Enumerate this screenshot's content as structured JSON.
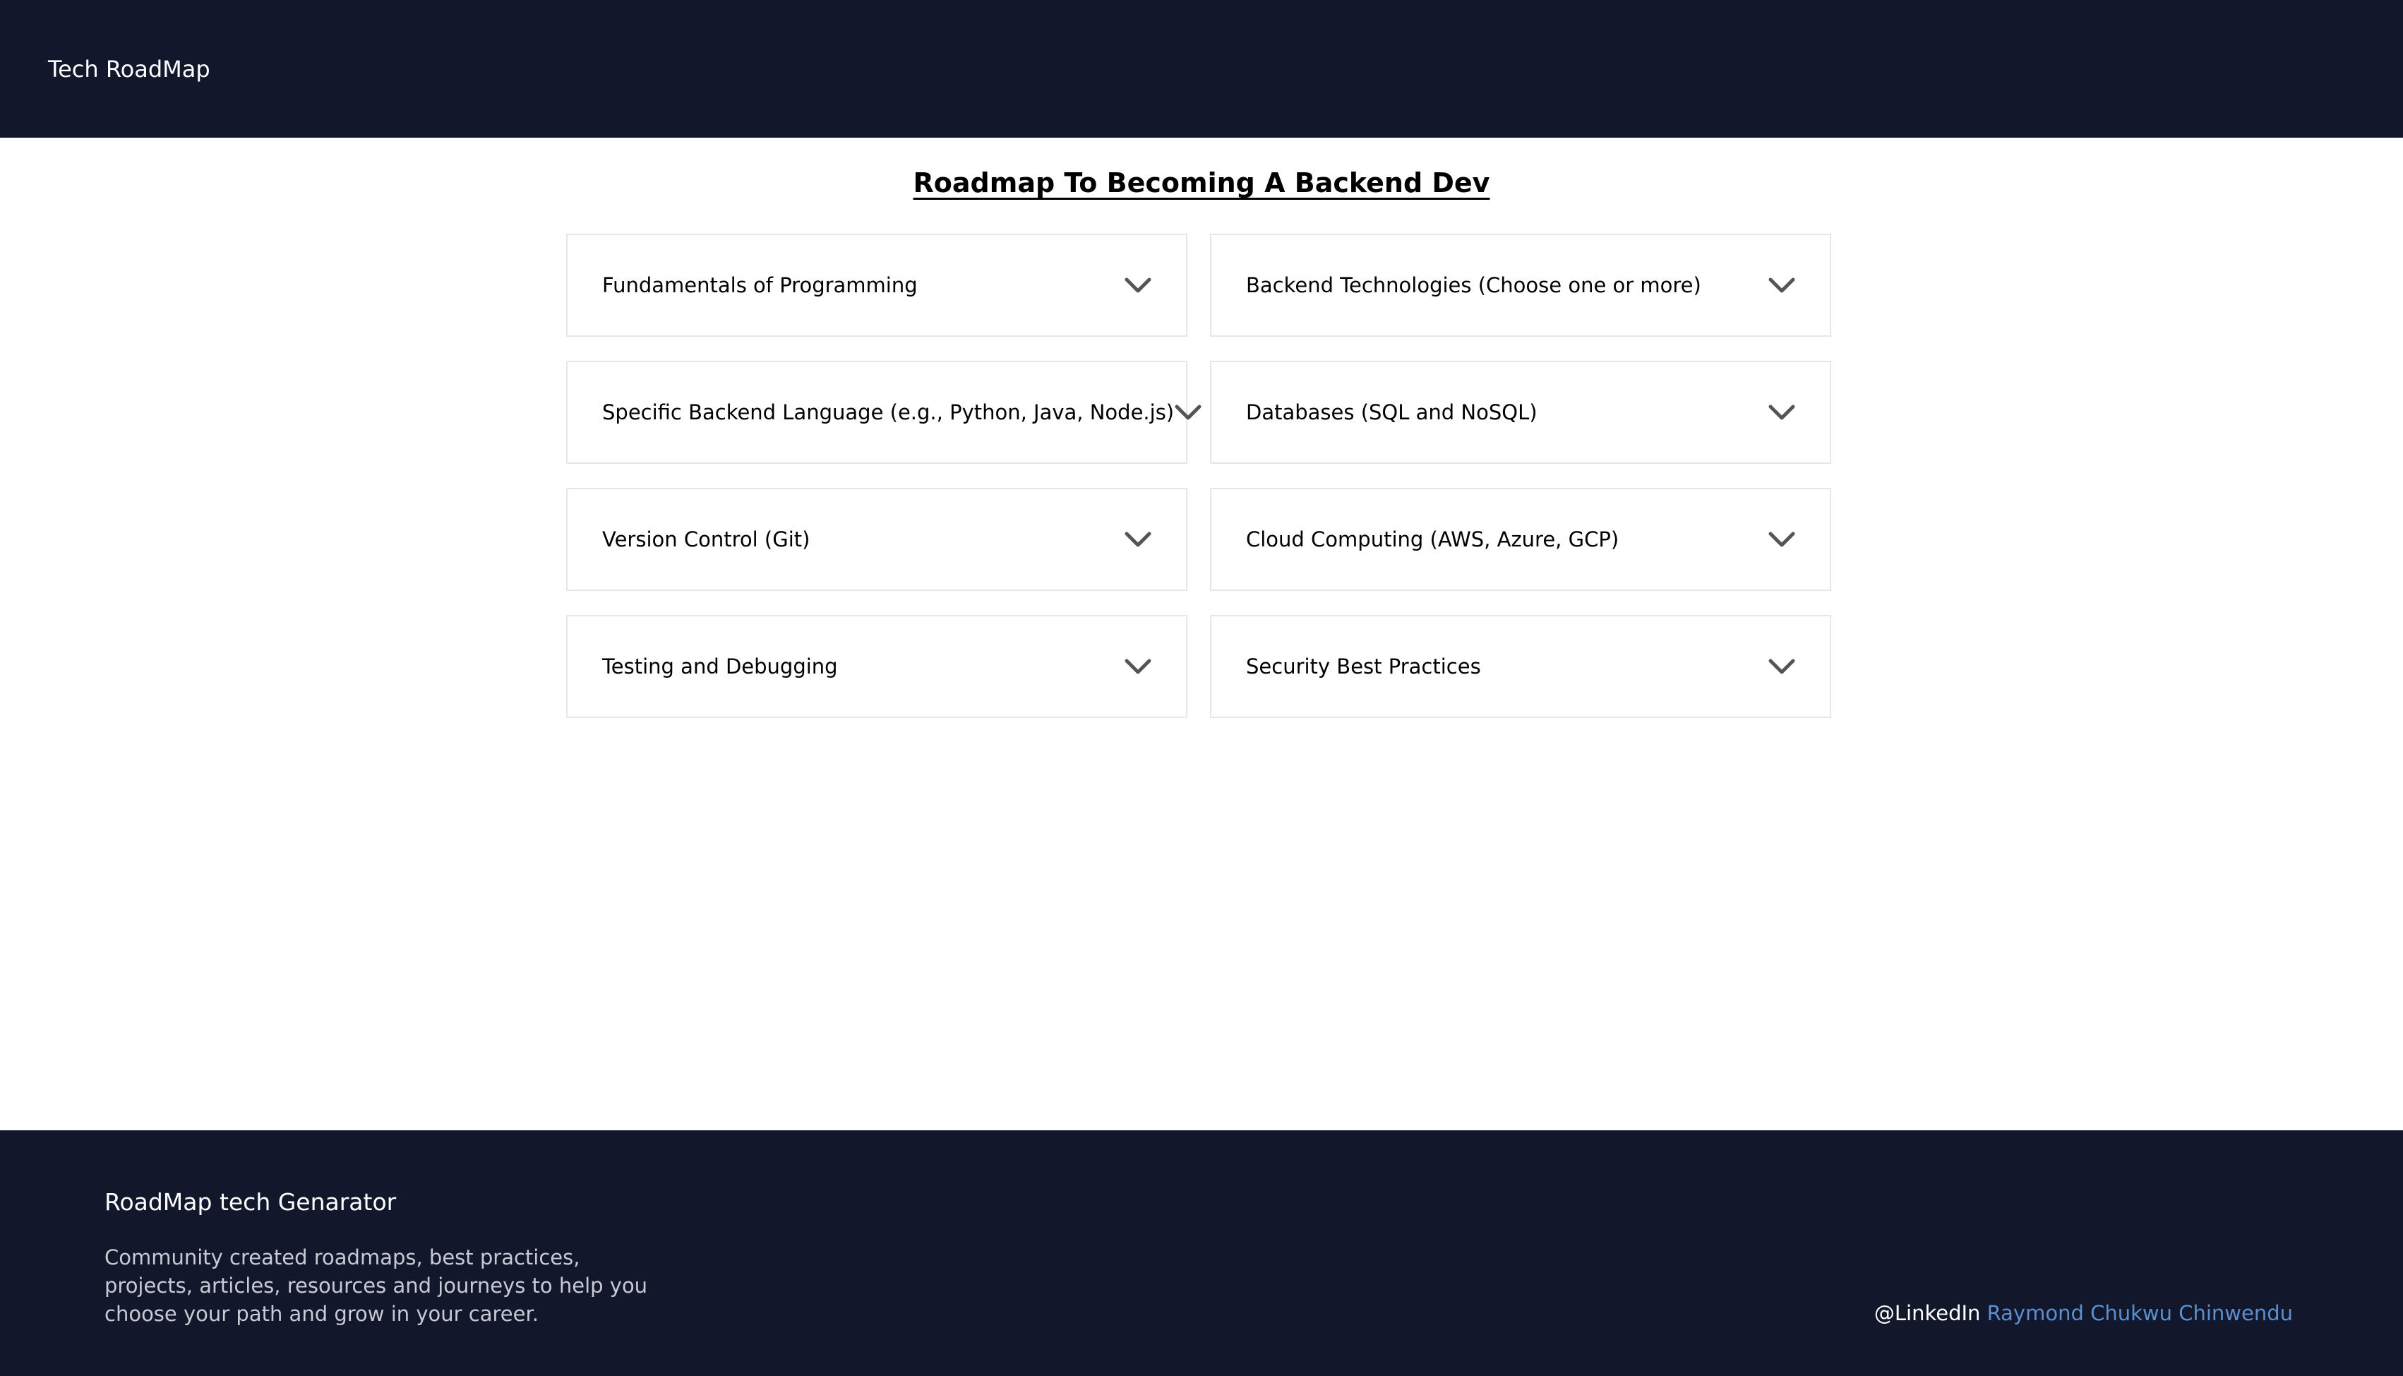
{
  "navbar": {
    "brand": "Tech RoadMap"
  },
  "main": {
    "title": "Roadmap To Becoming A Backend Dev",
    "topics": [
      {
        "label": "Fundamentals of Programming"
      },
      {
        "label": "Backend Technologies (Choose one or more)"
      },
      {
        "label": "Specific Backend Language (e.g., Python, Java, Node.js)"
      },
      {
        "label": "Databases (SQL and NoSQL)"
      },
      {
        "label": "Version Control (Git)"
      },
      {
        "label": "Cloud Computing (AWS, Azure, GCP)"
      },
      {
        "label": "Testing and Debugging"
      },
      {
        "label": "Security Best Practices"
      }
    ],
    "expand_icon": "chevron-down-icon"
  },
  "footer": {
    "title": "RoadMap tech Genarator",
    "description": "Community created roadmaps, best practices, projects, articles, resources and journeys to help you choose your path and grow in your career.",
    "credit_prefix": "@LinkedIn",
    "credit_name": "Raymond Chukwu Chinwendu"
  },
  "colors": {
    "navbar_bg": "#12172b",
    "footer_bg": "#12172b",
    "link": "#5b8fd0",
    "card_border": "#e5e7eb"
  }
}
